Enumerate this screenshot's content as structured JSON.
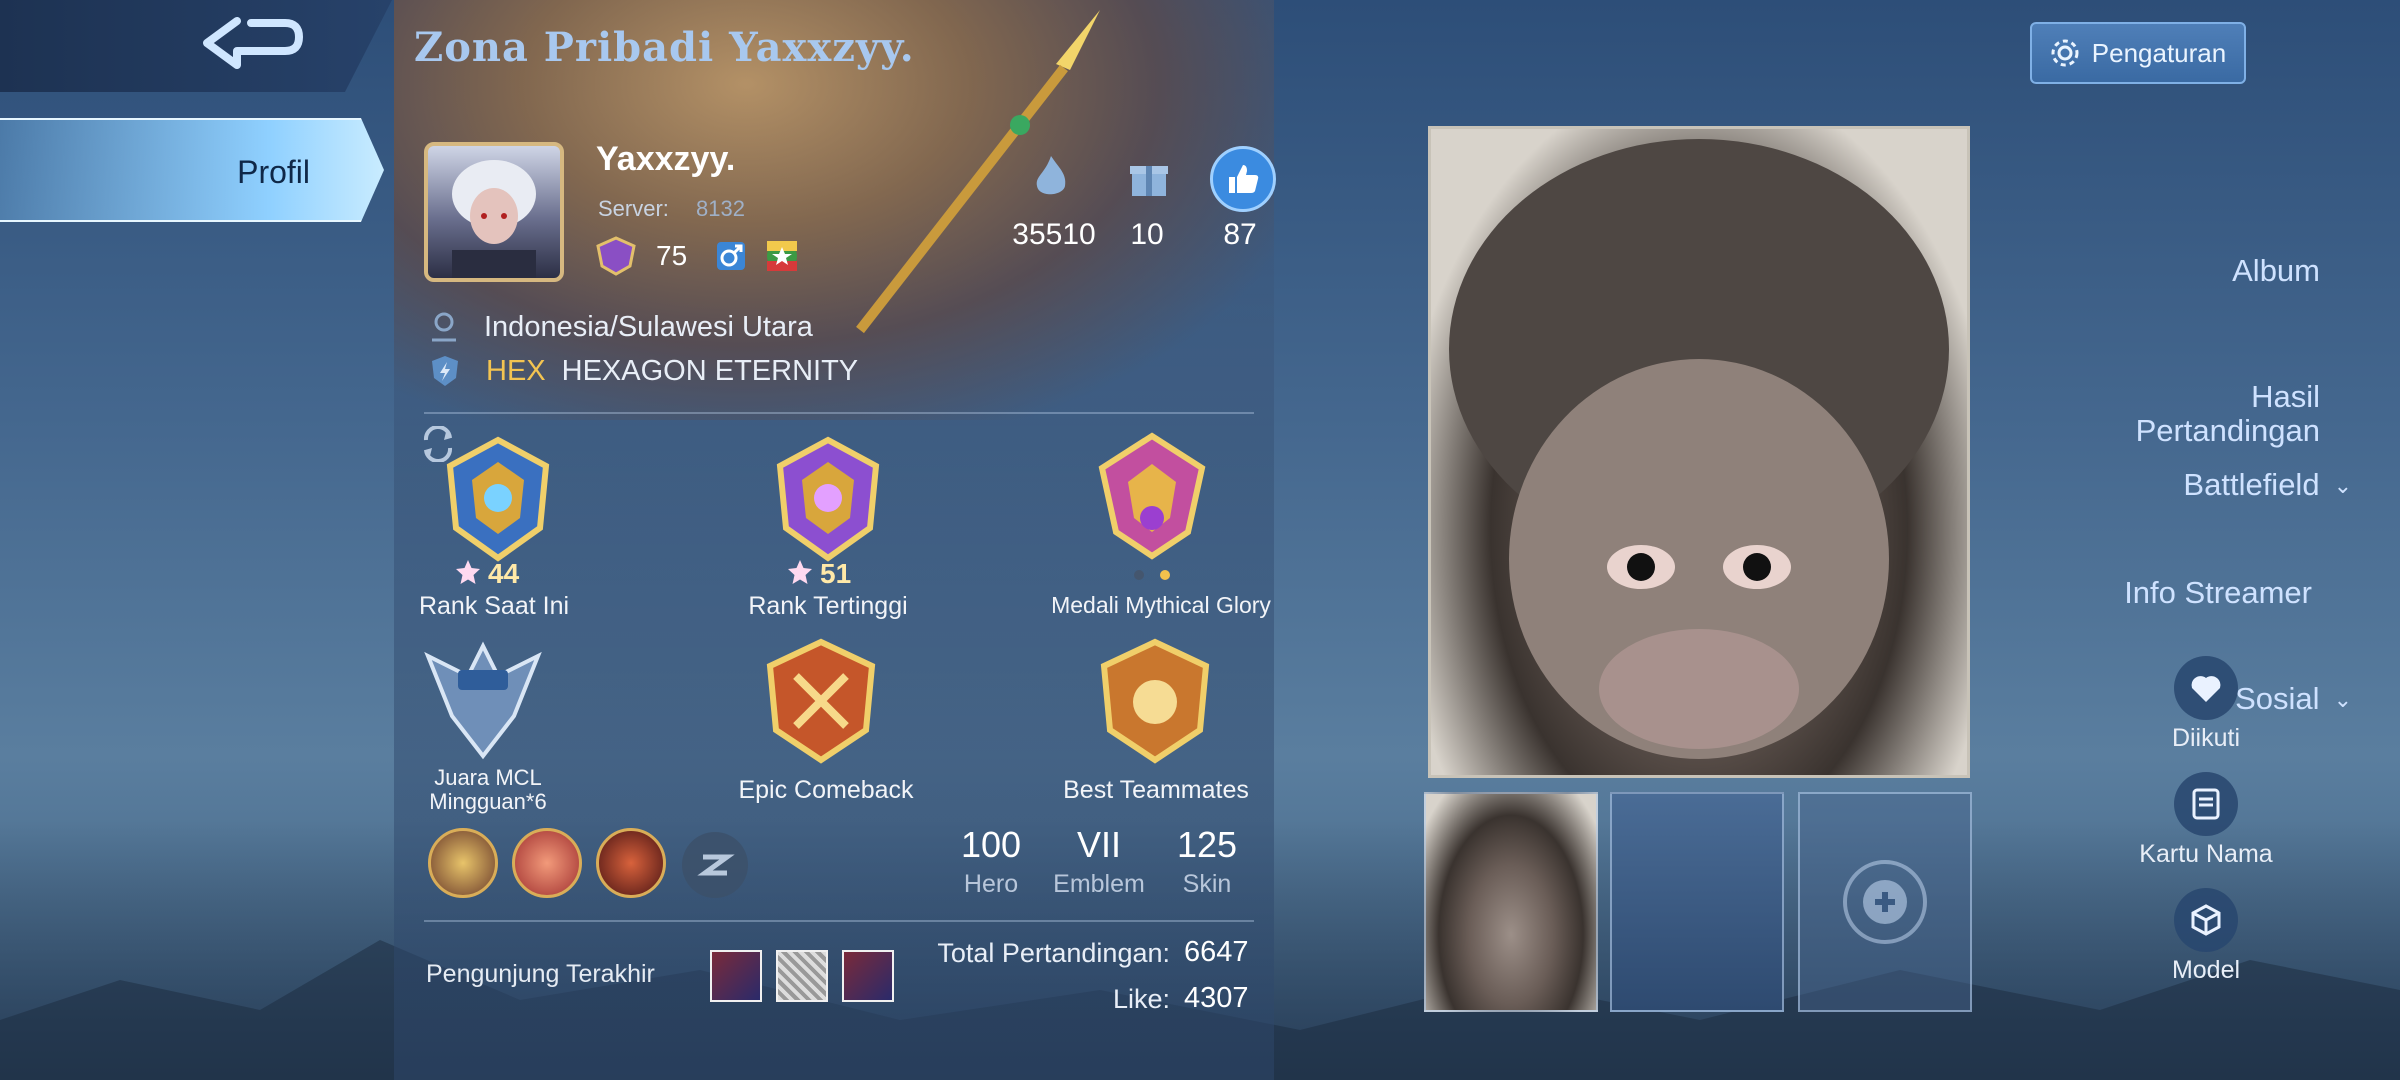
{
  "panel": {
    "title": "Zona Pribadi Yaxxzyy."
  },
  "nav": {
    "items": [
      {
        "label": "Profil",
        "active": true
      },
      {
        "label": "Album"
      },
      {
        "label": "Hasil\nPertandingan"
      },
      {
        "label": "Battlefield",
        "has_dropdown": true
      },
      {
        "label": "Info Streamer"
      },
      {
        "label": "Sosial",
        "has_dropdown": true
      }
    ]
  },
  "profile": {
    "username": "Yaxxzyy.",
    "server_label": "Server:",
    "server_id": "8132",
    "level": "75",
    "location": "Indonesia/Sulawesi Utara",
    "squad_tag": "HEX",
    "squad_name": "HEXAGON ETERNITY"
  },
  "stats": {
    "popularity": "35510",
    "gifts": "10",
    "likes": "87"
  },
  "medals": [
    {
      "label": "Rank Saat Ini",
      "stars": "44"
    },
    {
      "label": "Rank Tertinggi",
      "stars": "51"
    },
    {
      "label": "Medali Mythical Glory",
      "stars": ""
    },
    {
      "label": "Juara MCL\nMingguan*6"
    },
    {
      "label": "Epic Comeback"
    },
    {
      "label": "Best Teammates"
    }
  ],
  "collection": {
    "hero_value": "100",
    "hero_label": "Hero",
    "emblem_value": "VII",
    "emblem_label": "Emblem",
    "skin_value": "125",
    "skin_label": "Skin"
  },
  "footer": {
    "visitor_label": "Pengunjung Terakhir",
    "total_matches_label": "Total Pertandingan:",
    "total_matches": "6647",
    "like_label": "Like:",
    "like_value": "4307"
  },
  "right_rail": {
    "settings": "Pengaturan",
    "followed": "Diikuti",
    "name_card": "Kartu Nama",
    "model": "Model"
  },
  "colors": {
    "accent": "#8fd0ff",
    "gold": "#f3c451"
  }
}
